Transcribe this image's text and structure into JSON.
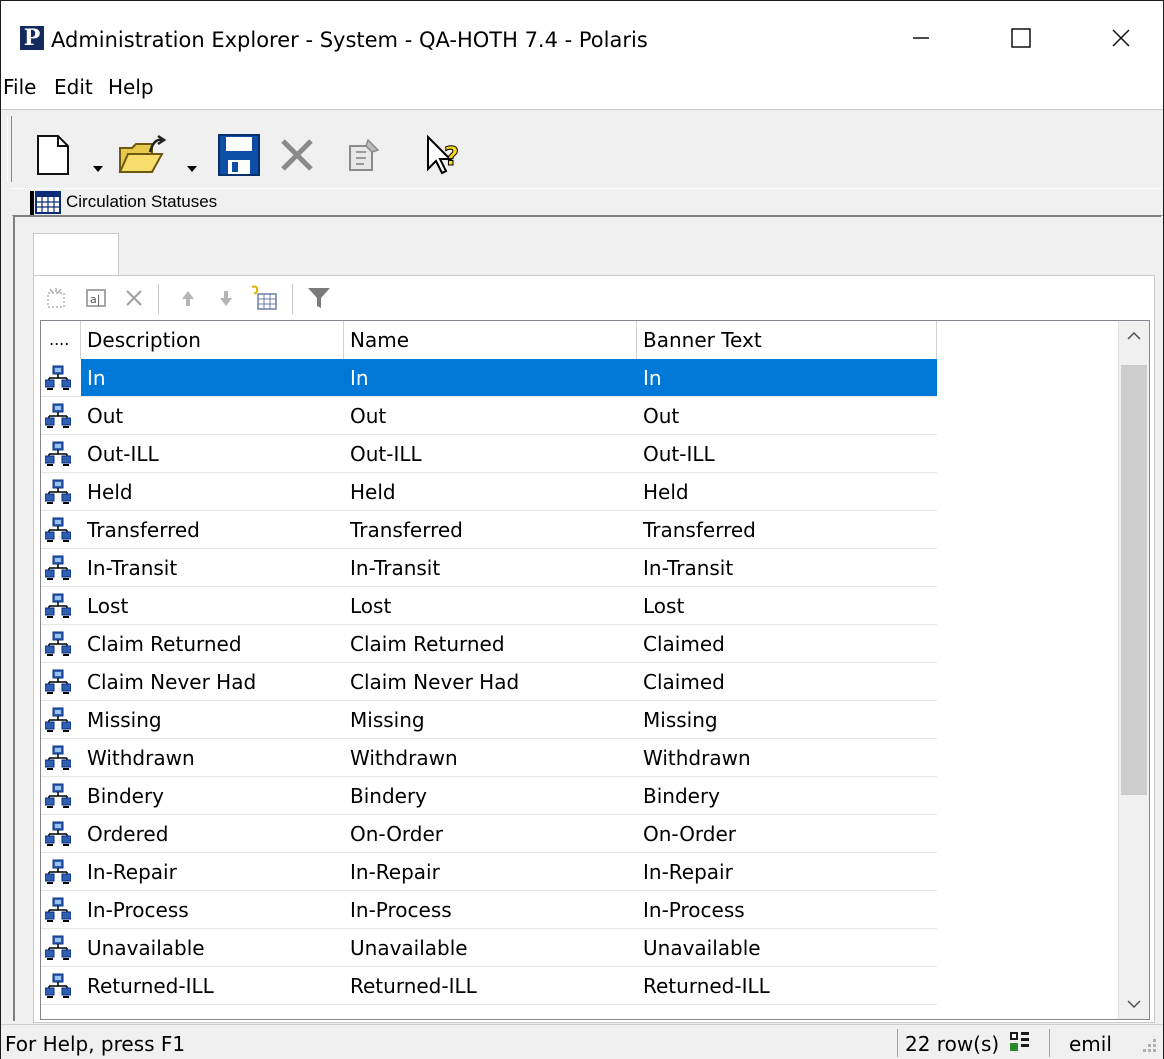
{
  "window": {
    "title": "Administration Explorer - System - QA-HOTH 7.4 - Polaris",
    "app_icon_letter": "P"
  },
  "menu": [
    "File",
    "Edit",
    "Help"
  ],
  "toolbar": {
    "icons": [
      "new-icon",
      "new-dropdown-icon",
      "open-icon",
      "open-dropdown-icon",
      "save-icon",
      "delete-icon",
      "properties-icon",
      "whats-this-help-icon"
    ]
  },
  "section": {
    "title": "Circulation Statuses",
    "icon": "table-icon"
  },
  "grid": {
    "toolbar_icons": [
      "new-row-icon",
      "edit-field-icon",
      "delete-row-icon",
      "move-up-icon",
      "move-down-icon",
      "insert-row-icon",
      "filter-icon"
    ],
    "row_selector_header": "....",
    "columns": [
      "Description",
      "Name",
      "Banner Text"
    ],
    "selected_row": 0,
    "rows": [
      [
        "In",
        "In",
        "In"
      ],
      [
        "Out",
        "Out",
        "Out"
      ],
      [
        "Out-ILL",
        "Out-ILL",
        "Out-ILL"
      ],
      [
        "Held",
        "Held",
        "Held"
      ],
      [
        "Transferred",
        "Transferred",
        "Transferred"
      ],
      [
        "In-Transit",
        "In-Transit",
        "In-Transit"
      ],
      [
        "Lost",
        "Lost",
        "Lost"
      ],
      [
        "Claim Returned",
        "Claim Returned",
        "Claimed"
      ],
      [
        "Claim Never Had",
        "Claim Never Had",
        "Claimed"
      ],
      [
        "Missing",
        "Missing",
        "Missing"
      ],
      [
        "Withdrawn",
        "Withdrawn",
        "Withdrawn"
      ],
      [
        "Bindery",
        "Bindery",
        "Bindery"
      ],
      [
        "Ordered",
        "On-Order",
        "On-Order"
      ],
      [
        "In-Repair",
        "In-Repair",
        "In-Repair"
      ],
      [
        "In-Process",
        "In-Process",
        "In-Process"
      ],
      [
        "Unavailable",
        "Unavailable",
        "Unavailable"
      ],
      [
        "Returned-ILL",
        "Returned-ILL",
        "Returned-ILL"
      ]
    ]
  },
  "status": {
    "help": "For Help, press F1",
    "row_count": "22 row(s)",
    "user": "emil"
  },
  "colors": {
    "selection": "#0078d7",
    "window_bg": "#f0f0f0"
  }
}
